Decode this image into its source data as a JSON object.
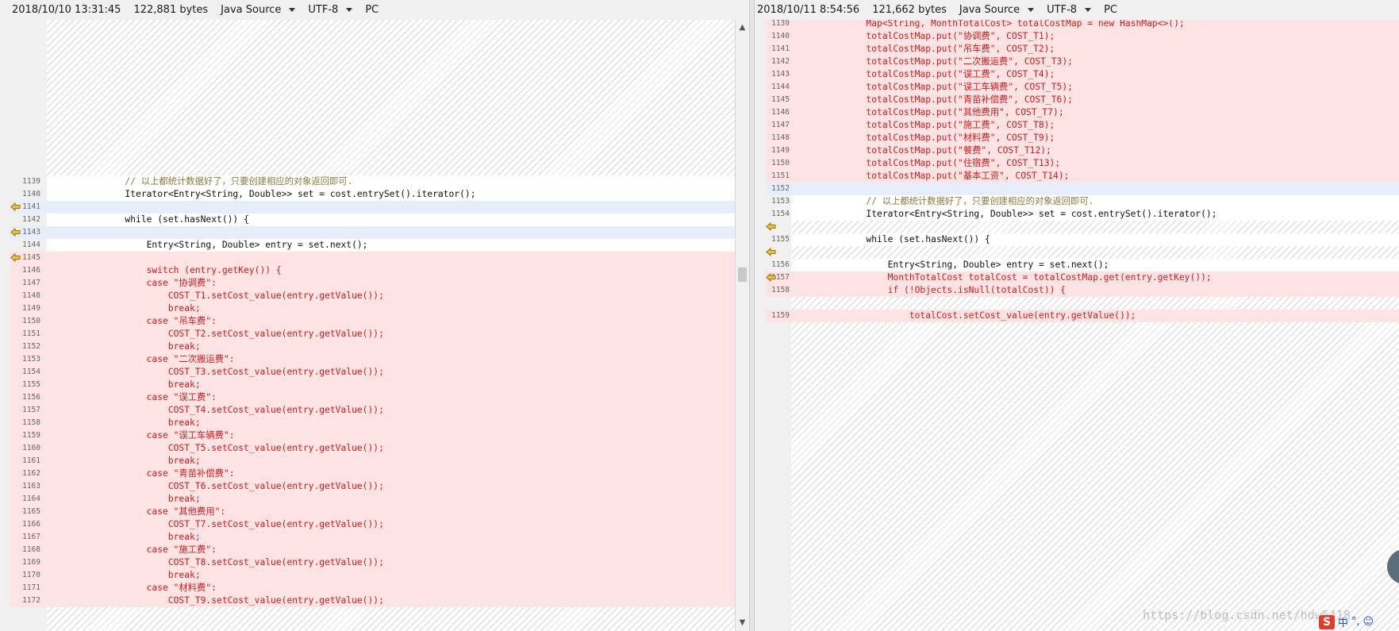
{
  "left_header": {
    "date": "2018/10/10 13:31:45",
    "size": "122,881 bytes",
    "language": "Java Source",
    "encoding": "UTF-8",
    "lineend": "PC"
  },
  "right_header": {
    "date": "2018/10/11 8:54:56",
    "size": "121,662 bytes",
    "language": "Java Source",
    "encoding": "UTF-8",
    "lineend": "PC"
  },
  "left_lines": [
    {
      "n": "1139",
      "t": "        // 以上都统计数据好了，只要创建相应的对象返回即可.",
      "k": "wht",
      "c": "cmt"
    },
    {
      "n": "1140",
      "t": "        Iterator<Entry<String, Double>> set = cost.entrySet().iterator();",
      "k": "wht",
      "c": ""
    },
    {
      "n": "1141",
      "t": "",
      "k": "blu",
      "c": "",
      "a": true
    },
    {
      "n": "1142",
      "t": "        while (set.hasNext()) {",
      "k": "wht",
      "c": ""
    },
    {
      "n": "1143",
      "t": "",
      "k": "blu",
      "c": "",
      "a": true
    },
    {
      "n": "1144",
      "t": "            Entry<String, Double> entry = set.next();",
      "k": "wht",
      "c": ""
    },
    {
      "n": "1145",
      "t": "",
      "k": "chg",
      "c": "",
      "a": true
    },
    {
      "n": "1146",
      "t": "            switch (entry.getKey()) {",
      "k": "chg",
      "c": "red"
    },
    {
      "n": "1147",
      "t": "            case \"协调费\":",
      "k": "chg",
      "c": "red"
    },
    {
      "n": "1148",
      "t": "                COST_T1.setCost_value(entry.getValue());",
      "k": "chg",
      "c": "red"
    },
    {
      "n": "1149",
      "t": "                break;",
      "k": "chg",
      "c": "red"
    },
    {
      "n": "1150",
      "t": "            case \"吊车费\":",
      "k": "chg",
      "c": "red"
    },
    {
      "n": "1151",
      "t": "                COST_T2.setCost_value(entry.getValue());",
      "k": "chg",
      "c": "red"
    },
    {
      "n": "1152",
      "t": "                break;",
      "k": "chg",
      "c": "red"
    },
    {
      "n": "1153",
      "t": "            case \"二次搬运费\":",
      "k": "chg",
      "c": "red"
    },
    {
      "n": "1154",
      "t": "                COST_T3.setCost_value(entry.getValue());",
      "k": "chg",
      "c": "red"
    },
    {
      "n": "1155",
      "t": "                break;",
      "k": "chg",
      "c": "red"
    },
    {
      "n": "1156",
      "t": "            case \"误工费\":",
      "k": "chg",
      "c": "red"
    },
    {
      "n": "1157",
      "t": "                COST_T4.setCost_value(entry.getValue());",
      "k": "chg",
      "c": "red"
    },
    {
      "n": "1158",
      "t": "                break;",
      "k": "chg",
      "c": "red"
    },
    {
      "n": "1159",
      "t": "            case \"误工车辆费\":",
      "k": "chg",
      "c": "red"
    },
    {
      "n": "1160",
      "t": "                COST_T5.setCost_value(entry.getValue());",
      "k": "chg",
      "c": "red"
    },
    {
      "n": "1161",
      "t": "                break;",
      "k": "chg",
      "c": "red"
    },
    {
      "n": "1162",
      "t": "            case \"青苗补偿费\":",
      "k": "chg",
      "c": "red"
    },
    {
      "n": "1163",
      "t": "                COST_T6.setCost_value(entry.getValue());",
      "k": "chg",
      "c": "red"
    },
    {
      "n": "1164",
      "t": "                break;",
      "k": "chg",
      "c": "red"
    },
    {
      "n": "1165",
      "t": "            case \"其他费用\":",
      "k": "chg",
      "c": "red"
    },
    {
      "n": "1166",
      "t": "                COST_T7.setCost_value(entry.getValue());",
      "k": "chg",
      "c": "red"
    },
    {
      "n": "1167",
      "t": "                break;",
      "k": "chg",
      "c": "red"
    },
    {
      "n": "1168",
      "t": "            case \"施工费\":",
      "k": "chg",
      "c": "red"
    },
    {
      "n": "1169",
      "t": "                COST_T8.setCost_value(entry.getValue());",
      "k": "chg",
      "c": "red"
    },
    {
      "n": "1170",
      "t": "                break;",
      "k": "chg",
      "c": "red"
    },
    {
      "n": "1171",
      "t": "            case \"材料费\":",
      "k": "chg",
      "c": "red"
    },
    {
      "n": "1172",
      "t": "                COST_T9.setCost_value(entry.getValue());",
      "k": "chg",
      "c": "red"
    }
  ],
  "right_lines": [
    {
      "n": "1139",
      "t": "        Map<String, MonthTotalCost> totalCostMap = new HashMap<>();",
      "k": "chg",
      "c": "red"
    },
    {
      "n": "1140",
      "t": "        totalCostMap.put(\"协调费\", COST_T1);",
      "k": "chg",
      "c": "red"
    },
    {
      "n": "1141",
      "t": "        totalCostMap.put(\"吊车费\", COST_T2);",
      "k": "chg",
      "c": "red"
    },
    {
      "n": "1142",
      "t": "        totalCostMap.put(\"二次搬运费\", COST_T3);",
      "k": "chg",
      "c": "red"
    },
    {
      "n": "1143",
      "t": "        totalCostMap.put(\"误工费\", COST_T4);",
      "k": "chg",
      "c": "red"
    },
    {
      "n": "1144",
      "t": "        totalCostMap.put(\"误工车辆费\", COST_T5);",
      "k": "chg",
      "c": "red"
    },
    {
      "n": "1145",
      "t": "        totalCostMap.put(\"青苗补偿费\", COST_T6);",
      "k": "chg",
      "c": "red"
    },
    {
      "n": "1146",
      "t": "        totalCostMap.put(\"其他费用\", COST_T7);",
      "k": "chg",
      "c": "red"
    },
    {
      "n": "1147",
      "t": "        totalCostMap.put(\"施工费\", COST_T8);",
      "k": "chg",
      "c": "red"
    },
    {
      "n": "1148",
      "t": "        totalCostMap.put(\"材料费\", COST_T9);",
      "k": "chg",
      "c": "red"
    },
    {
      "n": "1149",
      "t": "        totalCostMap.put(\"餐费\", COST_T12);",
      "k": "chg",
      "c": "red"
    },
    {
      "n": "1150",
      "t": "        totalCostMap.put(\"住宿费\", COST_T13);",
      "k": "chg",
      "c": "red"
    },
    {
      "n": "1151",
      "t": "        totalCostMap.put(\"基本工资\", COST_T14);",
      "k": "chg",
      "c": "red"
    },
    {
      "n": "1152",
      "t": "",
      "k": "blu",
      "c": ""
    },
    {
      "n": "1153",
      "t": "        // 以上都统计数据好了，只要创建相应的对象返回即可.",
      "k": "wht",
      "c": "cmt"
    },
    {
      "n": "1154",
      "t": "        Iterator<Entry<String, Double>> set = cost.entrySet().iterator();",
      "k": "wht",
      "c": ""
    },
    {
      "n": "",
      "t": "",
      "k": "hat",
      "c": "",
      "a": true
    },
    {
      "n": "1155",
      "t": "        while (set.hasNext()) {",
      "k": "wht",
      "c": ""
    },
    {
      "n": "",
      "t": "",
      "k": "hat",
      "c": "",
      "a": true
    },
    {
      "n": "1156",
      "t": "            Entry<String, Double> entry = set.next();",
      "k": "wht",
      "c": ""
    },
    {
      "n": "1157",
      "t": "            MonthTotalCost totalCost = totalCostMap.get(entry.getKey());",
      "k": "chg",
      "c": "red",
      "a": true
    },
    {
      "n": "1158",
      "t": "            if (!Objects.isNull(totalCost)) {",
      "k": "chg",
      "c": "red"
    },
    {
      "n": "",
      "t": "",
      "k": "hat",
      "c": ""
    },
    {
      "n": "1159",
      "t": "                totalCost.setCost_value(entry.getValue());",
      "k": "chg",
      "c": "red"
    }
  ],
  "watermark": "https://blog.csdn.net/hdw5418",
  "ime": {
    "logo": "S",
    "mode": "中",
    "punct": "°,",
    "emoji": "☺"
  }
}
